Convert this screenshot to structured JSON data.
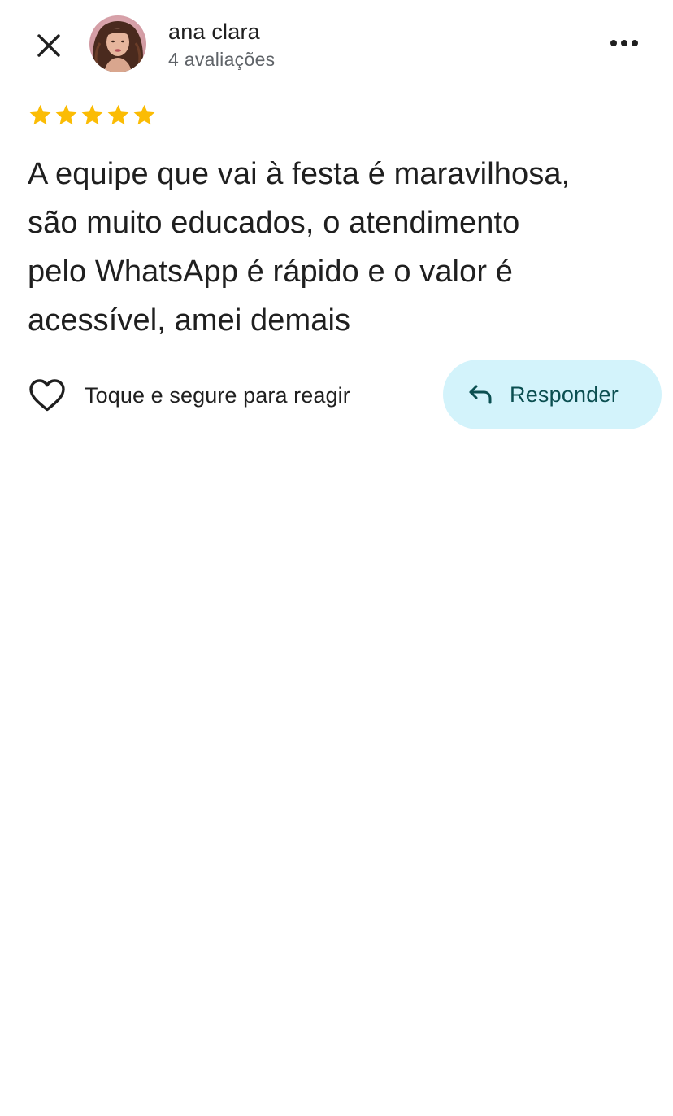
{
  "header": {
    "user_name": "ana clara",
    "user_reviews": "4 avaliações",
    "close_icon": "close-icon",
    "more_icon": "more-horizontal-icon"
  },
  "review": {
    "rating": 5,
    "rating_max": 5,
    "star_color": "#fbbc04",
    "text": "A equipe que vai à festa é maravilhosa,\nsão muito educados, o atendimento\npelo WhatsApp é rápido e o valor é\nacessível, amei demais"
  },
  "actions": {
    "react_label": "Toque e segure para reagir",
    "react_icon": "heart-outline-icon",
    "reply_label": "Responder",
    "reply_icon": "reply-arrow-icon",
    "reply_bg_color": "#d3f3fb",
    "reply_text_color": "#0b4f51"
  }
}
